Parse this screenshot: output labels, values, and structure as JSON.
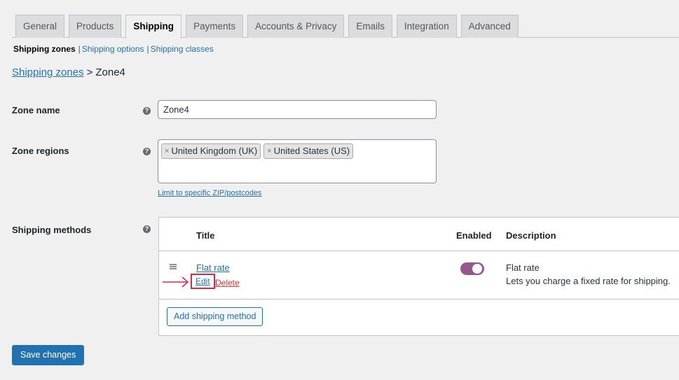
{
  "tabs": [
    {
      "label": "General",
      "active": false
    },
    {
      "label": "Products",
      "active": false
    },
    {
      "label": "Shipping",
      "active": true
    },
    {
      "label": "Payments",
      "active": false
    },
    {
      "label": "Accounts & Privacy",
      "active": false
    },
    {
      "label": "Emails",
      "active": false
    },
    {
      "label": "Integration",
      "active": false
    },
    {
      "label": "Advanced",
      "active": false
    }
  ],
  "subnav": {
    "current": "Shipping zones",
    "links": [
      "Shipping options",
      "Shipping classes"
    ]
  },
  "breadcrumb": {
    "link": "Shipping zones",
    "separator": ">",
    "current": "Zone4"
  },
  "form": {
    "zone_name_label": "Zone name",
    "zone_name_value": "Zone4",
    "zone_regions_label": "Zone regions",
    "regions": [
      "United Kingdom (UK)",
      "United States (US)"
    ],
    "chip_remove_glyph": "×",
    "limit_link": "Limit to specific ZIP/postcodes",
    "shipping_methods_label": "Shipping methods",
    "help_glyph": "?"
  },
  "methods_table": {
    "headers": {
      "title": "Title",
      "enabled": "Enabled",
      "description": "Description"
    },
    "rows": [
      {
        "title": "Flat rate",
        "edit": "Edit",
        "delete": "Delete",
        "enabled": true,
        "desc_title": "Flat rate",
        "desc_text": "Lets you charge a fixed rate for shipping."
      }
    ],
    "add_button": "Add shipping method"
  },
  "save_button": "Save changes",
  "colors": {
    "accent": "#2271b1",
    "toggle_on": "#96588a",
    "delete": "#d63638",
    "annotation": "#d6284a"
  }
}
